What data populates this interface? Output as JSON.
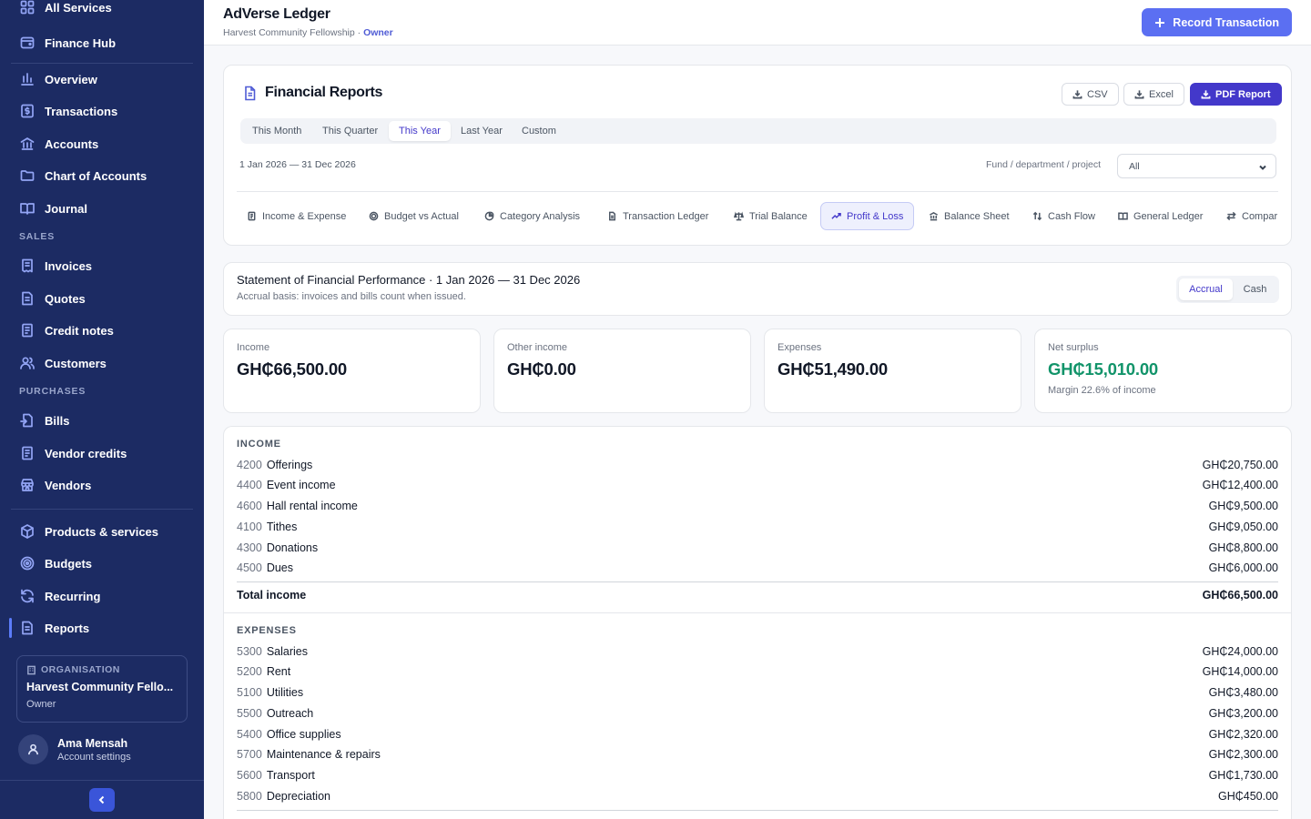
{
  "sidebar": {
    "all_services": "All Services",
    "finance_hub": "Finance Hub",
    "main_items": [
      {
        "label": "Overview"
      },
      {
        "label": "Transactions"
      },
      {
        "label": "Accounts"
      },
      {
        "label": "Chart of Accounts"
      },
      {
        "label": "Journal"
      }
    ],
    "sales_label": "SALES",
    "sales_items": [
      {
        "label": "Invoices"
      },
      {
        "label": "Quotes"
      },
      {
        "label": "Credit notes"
      },
      {
        "label": "Customers"
      }
    ],
    "purchases_label": "PURCHASES",
    "purchase_items": [
      {
        "label": "Bills"
      },
      {
        "label": "Vendor credits"
      },
      {
        "label": "Vendors"
      }
    ],
    "other_items": [
      {
        "label": "Products & services"
      },
      {
        "label": "Budgets"
      },
      {
        "label": "Recurring"
      },
      {
        "label": "Reports"
      }
    ],
    "org": {
      "label": "ORGANISATION",
      "name": "Harvest Community Fello...",
      "role": "Owner"
    },
    "user": {
      "name": "Ama Mensah",
      "sub": "Account settings"
    }
  },
  "header": {
    "title": "AdVerse Ledger",
    "org": "Harvest Community Fellowship",
    "separator": "·",
    "role": "Owner",
    "record_label": "Record Transaction"
  },
  "reports": {
    "title": "Financial Reports",
    "export": {
      "csv": "CSV",
      "excel": "Excel",
      "pdf": "PDF Report"
    },
    "periods": [
      "This Month",
      "This Quarter",
      "This Year",
      "Last Year",
      "Custom"
    ],
    "date_range": "1 Jan 2026 — 31 Dec 2026",
    "fund_label": "Fund / department / project",
    "fund_value": "All",
    "tabs": [
      "Income & Expense",
      "Budget vs Actual",
      "Category Analysis",
      "Transaction Ledger",
      "Trial Balance",
      "Profit & Loss",
      "Balance Sheet",
      "Cash Flow",
      "General Ledger",
      "Compar"
    ]
  },
  "statement": {
    "title": "Statement of Financial Performance · 1 Jan 2026 — 31 Dec 2026",
    "subtitle": "Accrual basis: invoices and bills count when issued.",
    "basis": [
      "Accrual",
      "Cash"
    ]
  },
  "stats": [
    {
      "label": "Income",
      "value": "GH₵66,500.00"
    },
    {
      "label": "Other income",
      "value": "GH₵0.00"
    },
    {
      "label": "Expenses",
      "value": "GH₵51,490.00"
    },
    {
      "label": "Net surplus",
      "value": "GH₵15,010.00",
      "note": "Margin 22.6% of income"
    }
  ],
  "pl": {
    "income_head": "INCOME",
    "income": [
      {
        "code": "4200",
        "name": "Offerings",
        "amount": "GH₵20,750.00"
      },
      {
        "code": "4400",
        "name": "Event income",
        "amount": "GH₵12,400.00"
      },
      {
        "code": "4600",
        "name": "Hall rental income",
        "amount": "GH₵9,500.00"
      },
      {
        "code": "4100",
        "name": "Tithes",
        "amount": "GH₵9,050.00"
      },
      {
        "code": "4300",
        "name": "Donations",
        "amount": "GH₵8,800.00"
      },
      {
        "code": "4500",
        "name": "Dues",
        "amount": "GH₵6,000.00"
      }
    ],
    "total_income_label": "Total income",
    "total_income": "GH₵66,500.00",
    "expenses_head": "EXPENSES",
    "expenses": [
      {
        "code": "5300",
        "name": "Salaries",
        "amount": "GH₵24,000.00"
      },
      {
        "code": "5200",
        "name": "Rent",
        "amount": "GH₵14,000.00"
      },
      {
        "code": "5100",
        "name": "Utilities",
        "amount": "GH₵3,480.00"
      },
      {
        "code": "5500",
        "name": "Outreach",
        "amount": "GH₵3,200.00"
      },
      {
        "code": "5400",
        "name": "Office supplies",
        "amount": "GH₵2,320.00"
      },
      {
        "code": "5700",
        "name": "Maintenance & repairs",
        "amount": "GH₵2,300.00"
      },
      {
        "code": "5600",
        "name": "Transport",
        "amount": "GH₵1,730.00"
      },
      {
        "code": "5800",
        "name": "Depreciation",
        "amount": "GH₵450.00"
      }
    ]
  },
  "colors": {
    "sidebar": "#1c2b63",
    "accent": "#4338ca",
    "record": "#5b6ff2",
    "surplus": "#12946a"
  }
}
